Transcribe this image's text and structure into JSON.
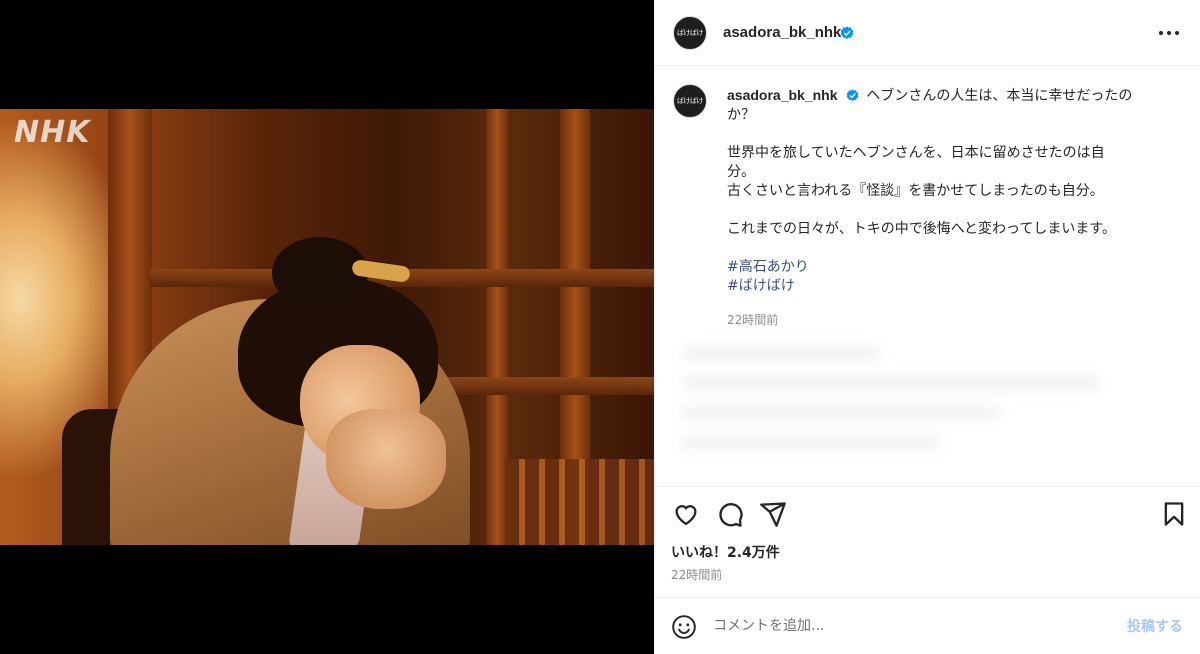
{
  "media": {
    "watermark": "NHK"
  },
  "header": {
    "avatar_text": "ばけばけ",
    "username": "asadora_bk_nhk"
  },
  "caption": {
    "username": "asadora_bk_nhk",
    "lines": [
      "ヘブンさんの人生は、本当に幸せだったの",
      "か？",
      "",
      "世界中を旅していたヘブンさんを、日本に留めさせたのは自",
      "分。",
      "古くさいと言われる『怪談』を書かせてしまったのも自分。",
      "",
      "これまでの日々が、トキの中で後悔へと変わってしまいます。",
      ""
    ],
    "hashtags": [
      "#高石あかり",
      "#ばけばけ"
    ],
    "timestamp": "22時間前"
  },
  "actions": {
    "icons": [
      "heart-icon",
      "comment-icon",
      "share-icon",
      "bookmark-icon"
    ]
  },
  "likes": "いいね！2.4万件",
  "timestamp": "22時間前",
  "comment_bar": {
    "placeholder": "コメントを追加...",
    "post_label": "投稿する"
  },
  "colors": {
    "verified": "#0095f6",
    "hashtag": "#385185",
    "post_button": "#a8c7fa",
    "muted": "#8e8e8e"
  }
}
